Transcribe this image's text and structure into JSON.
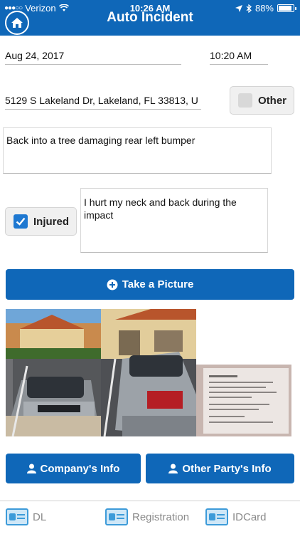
{
  "status_bar": {
    "carrier": "Verizon",
    "time": "10:26 AM",
    "battery": "88%",
    "battery_level": 0.88
  },
  "header": {
    "title": "Auto Incident"
  },
  "form": {
    "date": "Aug 24, 2017",
    "time": "10:20 AM",
    "address": "5129 S Lakeland Dr, Lakeland, FL 33813, U",
    "other_label": "Other",
    "other_checked": false,
    "description": "Back into a tree damaging rear left bumper",
    "injured_label": "Injured",
    "injured_checked": true,
    "injury_notes": "I hurt my neck  and back during the impact"
  },
  "actions": {
    "take_picture": "Take a Picture",
    "company_info": "Company's Info",
    "other_party_info": "Other Party's Info"
  },
  "photos": [
    "car-front-photo",
    "car-rear-photo",
    "document-photo"
  ],
  "tabs": [
    {
      "label": "DL",
      "icon": "id-card-icon"
    },
    {
      "label": "Registration",
      "icon": "id-card-icon"
    },
    {
      "label": "IDCard",
      "icon": "id-card-icon"
    }
  ],
  "colors": {
    "brand": "#0f67b8",
    "check": "#1e78d1",
    "tab_icon": "#3d9bd9"
  }
}
